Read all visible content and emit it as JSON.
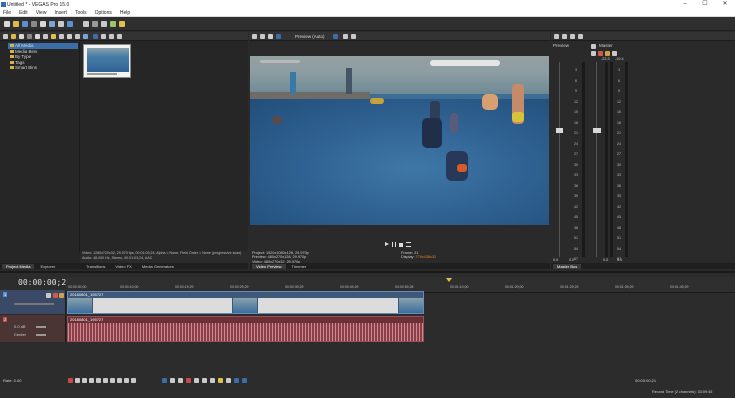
{
  "window": {
    "title": "Untitled * - VEGAS Pro 15.0",
    "buttons": [
      "–",
      "☐",
      "✕"
    ]
  },
  "menu": [
    "File",
    "Edit",
    "View",
    "Insert",
    "Tools",
    "Options",
    "Help"
  ],
  "explorer": {
    "tree": [
      {
        "label": "All Media",
        "selected": true
      },
      {
        "label": "Media Bins",
        "selected": false
      },
      {
        "label": "By Type",
        "selected": false
      },
      {
        "label": "Tags",
        "selected": false
      },
      {
        "label": "Smart Bins",
        "selected": false
      }
    ],
    "media_info_line1": "Video: 1280x720x32, 29.970 fps, 00:01:03;24, Alpha = None, Field Order = None (progressive scan)",
    "media_info_line2": "Audio: 48,000 Hz, Stereo, 00:01:03;24, AAC",
    "tabs_left": [
      "Project Media",
      "Explorer"
    ],
    "tabs_right": [
      "Transitions",
      "Video FX",
      "Media Generators"
    ]
  },
  "preview": {
    "quality": "Preview (Auto)",
    "project_label": "Project:",
    "project_value": "1920x1080x128, 29.970p",
    "preview_label": "Preview:",
    "preview_value": "480x270x128, 29.970p",
    "video_label": "Video:",
    "video_value": "480x270x32, 29.970p",
    "frame_label": "Frame:",
    "frame_value": "21",
    "display_label": "Display:",
    "display_value": "779x438x32",
    "tabs": [
      "Video Preview",
      "Trimmer"
    ]
  },
  "master": {
    "preview_label": "Preview",
    "master_label": "Master",
    "peak_left": "-22.3",
    "peak_right": "-19.4",
    "scale": [
      "3",
      "6",
      "9",
      "12",
      "15",
      "18",
      "21",
      "24",
      "27",
      "30",
      "33",
      "36",
      "39",
      "42",
      "45",
      "48",
      "51",
      "54",
      "57"
    ],
    "bottom_values": [
      "0.0",
      "0.0",
      "0.0",
      "0.0"
    ],
    "tab": "Master Bus"
  },
  "timeline": {
    "timecode": "00:00:00;21",
    "ruler": [
      "00:00:00;00",
      "00:00:10;00",
      "00:00:19;29",
      "00:00:29;29",
      "00:00:39;29",
      "00:00:49;29",
      "00:00:59;28",
      "00:01:10;00",
      "00:01:20;00",
      "00:01:29;29",
      "00:01:39;29",
      "00:01:49;29",
      "00:01:59;28",
      "00:02:10;00"
    ],
    "video_clip": "20180801_195727",
    "audio_clip": "20180801_195727",
    "audio_vol": "0.0 dB",
    "audio_pan": "Center",
    "track1": "1",
    "track2": "2",
    "rate_label": "Rate: 0.00",
    "end_timecode": "00:00:00;21",
    "status": "Record Time (2 channels): 33:09:45"
  }
}
